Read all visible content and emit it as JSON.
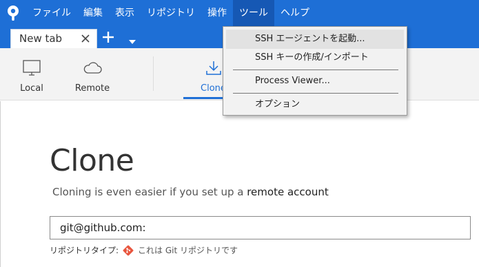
{
  "menubar": {
    "items": [
      "ファイル",
      "編集",
      "表示",
      "リポジトリ",
      "操作",
      "ツール",
      "ヘルプ"
    ],
    "active_index": 5
  },
  "tabs": {
    "items": [
      {
        "label": "New tab"
      }
    ]
  },
  "toolbar": {
    "local_label": "Local",
    "remote_label": "Remote",
    "clone_label": "Clone"
  },
  "tools_menu": {
    "items": [
      {
        "label": "SSH エージェントを起動..."
      },
      {
        "label": "SSH キーの作成/インポート"
      },
      {
        "label": "Process Viewer..."
      },
      {
        "label": "オプション"
      }
    ]
  },
  "clone": {
    "title": "Clone",
    "subtitle_text": "Cloning is even easier if you set up a ",
    "subtitle_link": "remote account",
    "url_value": "git@github.com:",
    "repo_type_label": "リポジトリタイプ:",
    "repo_type_value": "これは Git リポジトリです"
  },
  "colors": {
    "accent": "#1e6fd6",
    "menu_active": "#1658b4",
    "git_icon": "#e8553e"
  }
}
